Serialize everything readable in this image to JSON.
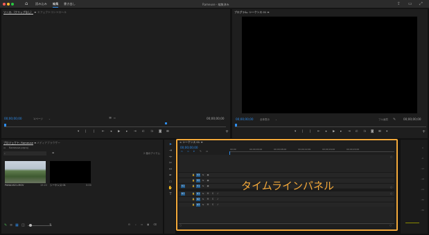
{
  "topbar": {
    "nav": [
      "読み込み",
      "編集",
      "書き出し"
    ],
    "active_index": 1,
    "title": "Rameuse - 編集済み"
  },
  "source_panel": {
    "tabs": [
      "ソース:（クリップなし）",
      "エフェクトコントロール"
    ],
    "timecode_left": "00;00;00;00",
    "fit": "1/ページ",
    "timecode_right": "00;00;00;00"
  },
  "program_panel": {
    "title": "プログラム: シーケンス 01",
    "timecode_left": "00;00;00;00",
    "fit": "全体表示",
    "quality": "フル画質",
    "timecode_right": "00;00;00;00"
  },
  "project_panel": {
    "tabs": [
      "プロジェクト: Rameuse",
      "メディアブラウザー"
    ],
    "file": "Rameuse.prproj",
    "item_count": "2 個のアイテム",
    "items": [
      {
        "name": "PANA1621.MOV",
        "duration": "15:22"
      },
      {
        "name": "シーケンス 01",
        "duration": "0:00"
      }
    ]
  },
  "timeline_panel": {
    "title": "シーケンス 01",
    "timecode": "00;00;00;00",
    "ruler": [
      "00;00",
      "00;00;04;00",
      "00;00;08;00",
      "00;00;12;00",
      "00;00;16;00",
      "00;00;20;00"
    ],
    "video_tracks": [
      "V3",
      "V2",
      "V1"
    ],
    "audio_tracks": [
      "A1",
      "A2",
      "A3"
    ],
    "annotation": "タイムラインパネル"
  },
  "colors": {
    "accent": "#2d8ceb",
    "highlight": "#f4a93a"
  }
}
